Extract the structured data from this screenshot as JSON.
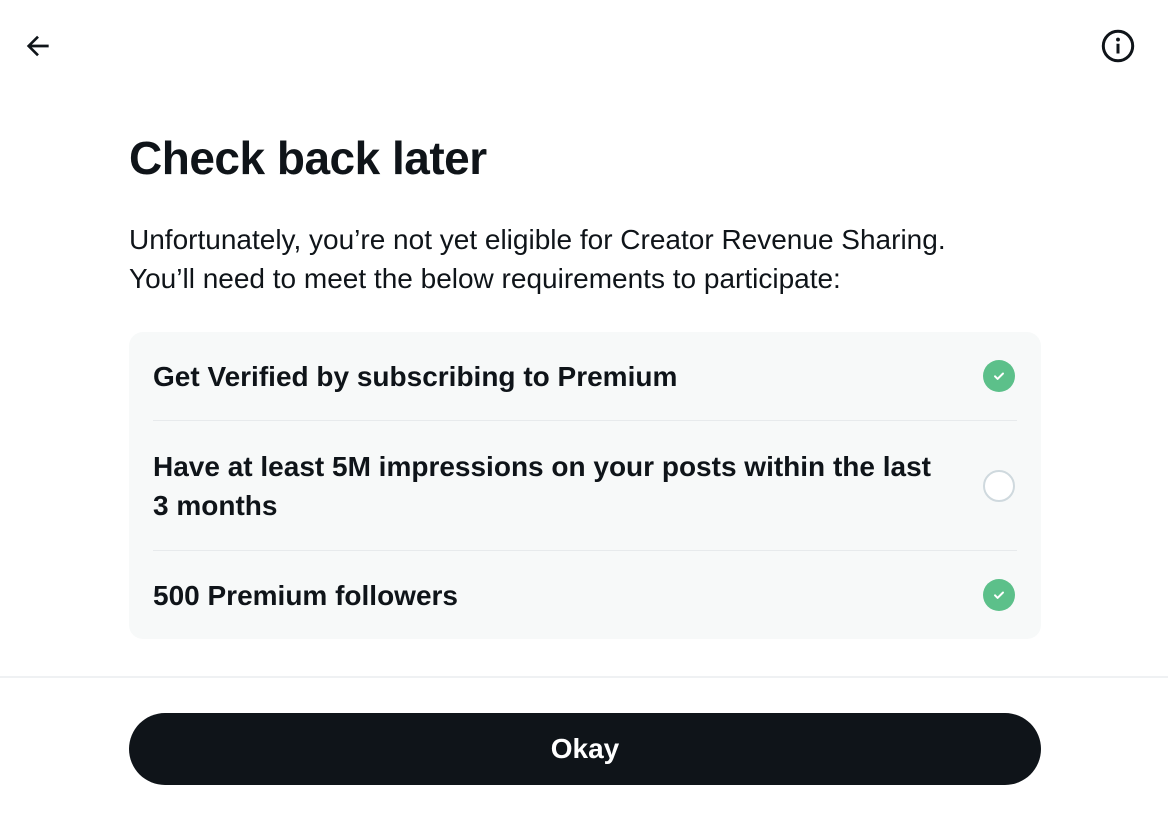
{
  "header": {
    "back_icon": "arrow-left-icon",
    "info_icon": "info-circle-icon"
  },
  "main": {
    "title": "Check back later",
    "description_line1": "Unfortunately, you’re not yet eligible for Creator Revenue Sharing.",
    "description_line2": "You’ll need to meet the below requirements to participate:"
  },
  "requirements": [
    {
      "label": "Get Verified by subscribing to Premium",
      "met": true
    },
    {
      "label": "Have at least 5M impressions on your posts within the last 3 months",
      "met": false
    },
    {
      "label": "500 Premium followers",
      "met": true
    }
  ],
  "footer": {
    "okay_label": "Okay"
  },
  "colors": {
    "text": "#0f1419",
    "check_green": "#5cc08a",
    "panel_bg": "#f7f9f9",
    "button_bg": "#0f1419"
  }
}
